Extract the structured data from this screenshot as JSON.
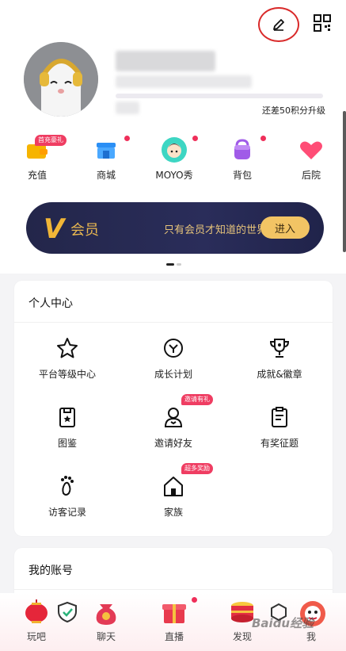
{
  "profile": {
    "level_hint": "还差50积分升级",
    "level_progress": 0.0
  },
  "quick_actions": [
    {
      "label": "充值",
      "icon": "recharge-wallet-icon",
      "tag": "首充豪礼",
      "dot": false
    },
    {
      "label": "商城",
      "icon": "shop-icon",
      "tag": "",
      "dot": true
    },
    {
      "label": "MOYO秀",
      "icon": "moyo-avatar-icon",
      "tag": "",
      "dot": true
    },
    {
      "label": "背包",
      "icon": "backpack-icon",
      "tag": "",
      "dot": true
    },
    {
      "label": "后院",
      "icon": "heart-icon",
      "tag": "",
      "dot": false
    }
  ],
  "vip": {
    "badge": "V",
    "title": "会员",
    "slogan": "只有会员才知道的世界",
    "button": "进入"
  },
  "personal_center": {
    "title": "个人中心",
    "items": [
      {
        "label": "平台等级中心",
        "icon": "star-icon",
        "tag": ""
      },
      {
        "label": "成长计划",
        "icon": "growth-clock-icon",
        "tag": ""
      },
      {
        "label": "成就&徽章",
        "icon": "trophy-icon",
        "tag": ""
      },
      {
        "label": "图鉴",
        "icon": "album-icon",
        "tag": ""
      },
      {
        "label": "邀请好友",
        "icon": "invite-user-icon",
        "tag": "邀请有礼"
      },
      {
        "label": "有奖征题",
        "icon": "clipboard-icon",
        "tag": ""
      },
      {
        "label": "访客记录",
        "icon": "footprint-icon",
        "tag": ""
      },
      {
        "label": "家族",
        "icon": "home-icon",
        "tag": "超多奖励"
      }
    ]
  },
  "account": {
    "title": "我的账号"
  },
  "tabbar": [
    {
      "label": "玩吧",
      "icon": "lantern-icon"
    },
    {
      "label": "聊天",
      "icon": "lucky-bag-icon"
    },
    {
      "label": "直播",
      "icon": "gift-box-icon"
    },
    {
      "label": "发现",
      "icon": "drum-icon"
    },
    {
      "label": "我",
      "icon": "lion-dance-icon"
    }
  ],
  "watermark": "Baidu经验",
  "colors": {
    "accent_red": "#ef2f5a",
    "vip_gold": "#f2c464",
    "vip_bg": "#23264a"
  }
}
